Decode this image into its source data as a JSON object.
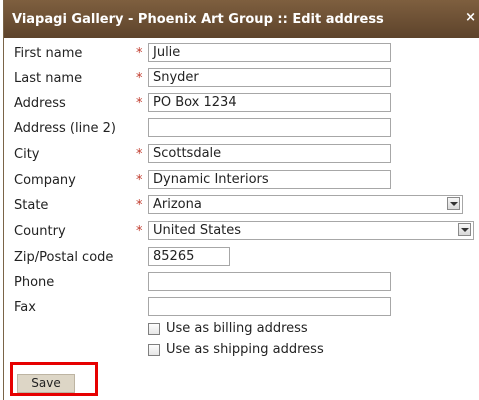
{
  "dialog": {
    "title": "Viapagi Gallery - Phoenix Art Group :: Edit address",
    "close_glyph": "×"
  },
  "form": {
    "required_marker": "*",
    "fields": [
      {
        "label": "First name",
        "value": "Julie",
        "required": true
      },
      {
        "label": "Last name",
        "value": "Snyder",
        "required": true
      },
      {
        "label": "Address",
        "value": "PO Box 1234",
        "required": true
      },
      {
        "label": "Address (line 2)",
        "value": "",
        "required": false
      },
      {
        "label": "City",
        "value": "Scottsdale",
        "required": true
      },
      {
        "label": "Company",
        "value": "Dynamic Interiors",
        "required": true
      },
      {
        "label": "State",
        "value": "Arizona",
        "required": true,
        "type": "select"
      },
      {
        "label": "Country",
        "value": "United States",
        "required": true,
        "type": "select"
      },
      {
        "label": "Zip/Postal code",
        "value": "85265",
        "required": false
      },
      {
        "label": "Phone",
        "value": "",
        "required": false
      },
      {
        "label": "Fax",
        "value": "",
        "required": false
      }
    ],
    "checkboxes": [
      {
        "label": "Use as billing address",
        "checked": false
      },
      {
        "label": "Use as shipping address",
        "checked": false
      }
    ],
    "save_label": "Save"
  },
  "colors": {
    "titlebar": "#6e5236",
    "required": "#c0392b",
    "highlight": "#e60000",
    "button": "#ddd6c6"
  }
}
